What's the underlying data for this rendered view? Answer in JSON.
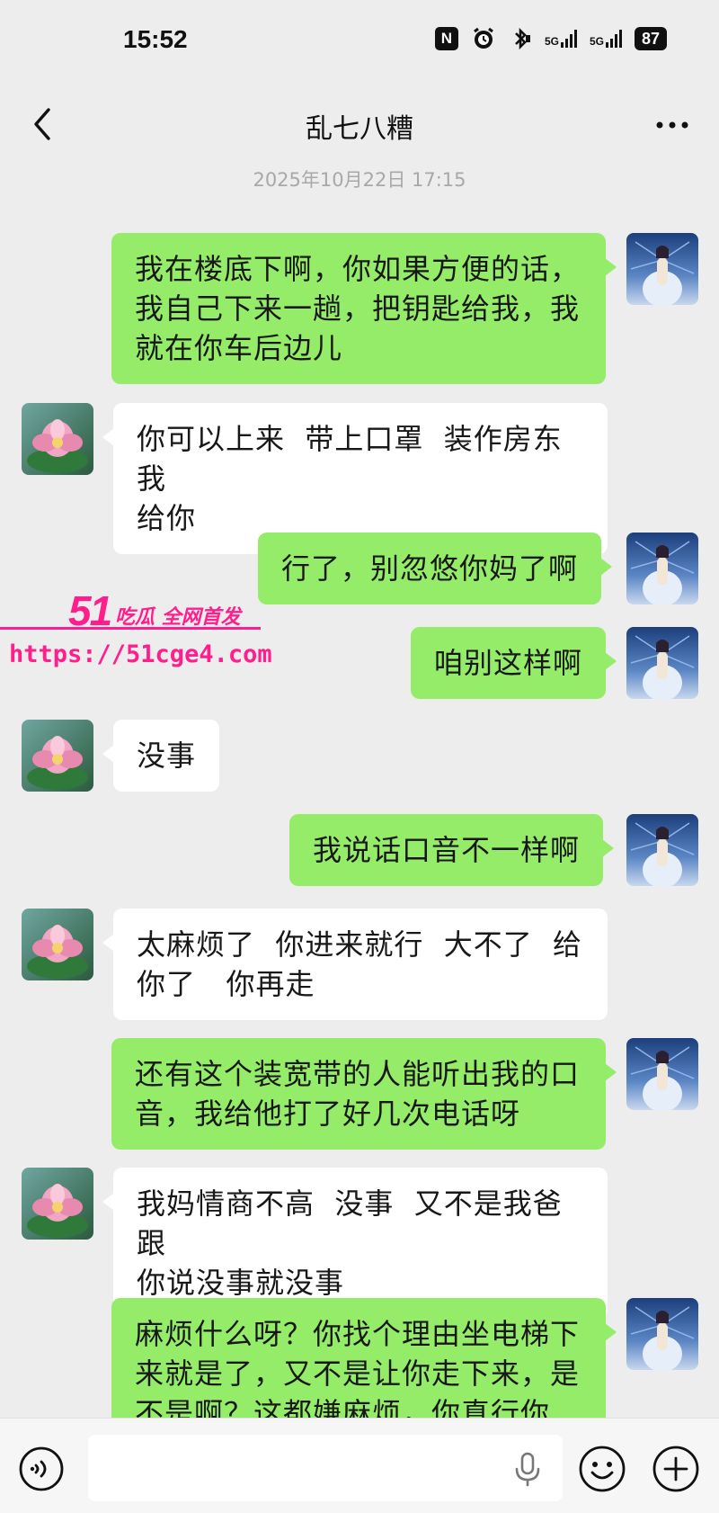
{
  "status_bar": {
    "time": "15:52",
    "nfc_label": "N",
    "network_1": "5G",
    "network_2": "5G",
    "battery": "87"
  },
  "header": {
    "title": "乱七八糟"
  },
  "timestamp": "2025年10月22日 17:15",
  "messages": [
    {
      "from": "me",
      "text": "我在楼底下啊，你如果方便的话，\n我自己下来一趟，把钥匙给我，我\n就在你车后边儿"
    },
    {
      "from": "other",
      "text": "你可以上来  带上口罩  装作房东我\n给你"
    },
    {
      "from": "me",
      "text": "行了，别忽悠你妈了啊"
    },
    {
      "from": "me",
      "text": "咱别这样啊"
    },
    {
      "from": "other",
      "text": "没事"
    },
    {
      "from": "me",
      "text": "我说话口音不一样啊"
    },
    {
      "from": "other",
      "text": "太麻烦了  你进来就行  大不了  给\n你了   你再走"
    },
    {
      "from": "me",
      "text": "还有这个装宽带的人能听出我的口\n音，我给他打了好几次电话呀"
    },
    {
      "from": "other",
      "text": "我妈情商不高  没事  又不是我爸  跟\n你说没事就没事"
    },
    {
      "from": "me",
      "text": "麻烦什么呀？你找个理由坐电梯下\n来就是了，又不是让你走下来，是\n不是啊？这都嫌麻烦，你真行你"
    }
  ],
  "watermark": {
    "logo": "51",
    "tagline": "吃瓜 全网首发",
    "url": "https://51cge4.com"
  },
  "input_bar": {
    "placeholder": ""
  },
  "colors": {
    "background": "#ededed",
    "my_bubble": "#95ec69",
    "other_bubble": "#ffffff",
    "watermark": "#ff1e8c"
  }
}
